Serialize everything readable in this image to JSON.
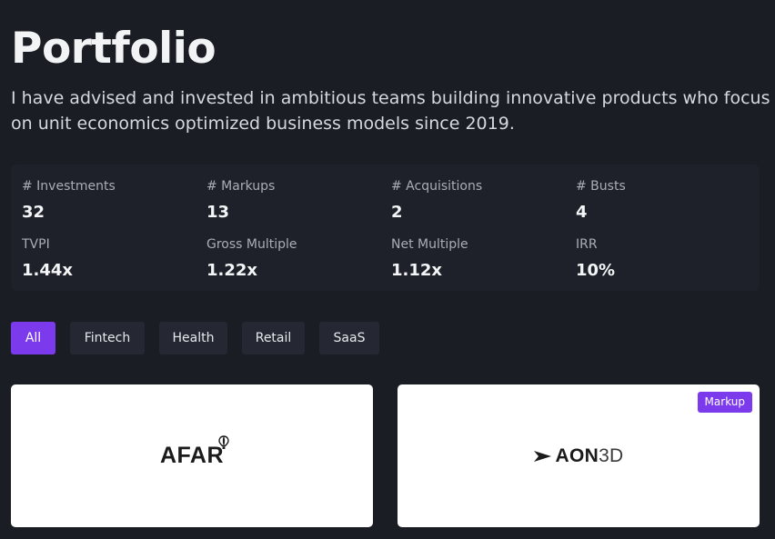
{
  "header": {
    "title": "Portfolio",
    "intro": "I have advised and invested in ambitious teams building innovative products who focus on unit economics optimized business models since 2019."
  },
  "stats": [
    {
      "label": "# Investments",
      "value": "32"
    },
    {
      "label": "# Markups",
      "value": "13"
    },
    {
      "label": "# Acquisitions",
      "value": "2"
    },
    {
      "label": "# Busts",
      "value": "4"
    },
    {
      "label": "TVPI",
      "value": "1.44x"
    },
    {
      "label": "Gross Multiple",
      "value": "1.22x"
    },
    {
      "label": "Net Multiple",
      "value": "1.12x"
    },
    {
      "label": "IRR",
      "value": "10%"
    }
  ],
  "filters": [
    {
      "label": "All",
      "active": true
    },
    {
      "label": "Fintech",
      "active": false
    },
    {
      "label": "Health",
      "active": false
    },
    {
      "label": "Retail",
      "active": false
    },
    {
      "label": "SaaS",
      "active": false
    }
  ],
  "cards": [
    {
      "logo_text": "AFAR",
      "logo_icon": "hot-air-balloon-icon"
    },
    {
      "logo_text": "AON",
      "logo_suffix": "3D",
      "logo_icon": "arrow-mark-icon",
      "badge": "Markup"
    }
  ],
  "colors": {
    "background": "#1a1d24",
    "panel": "#1e2129",
    "chip": "#252833",
    "accent": "#7c3aed"
  }
}
